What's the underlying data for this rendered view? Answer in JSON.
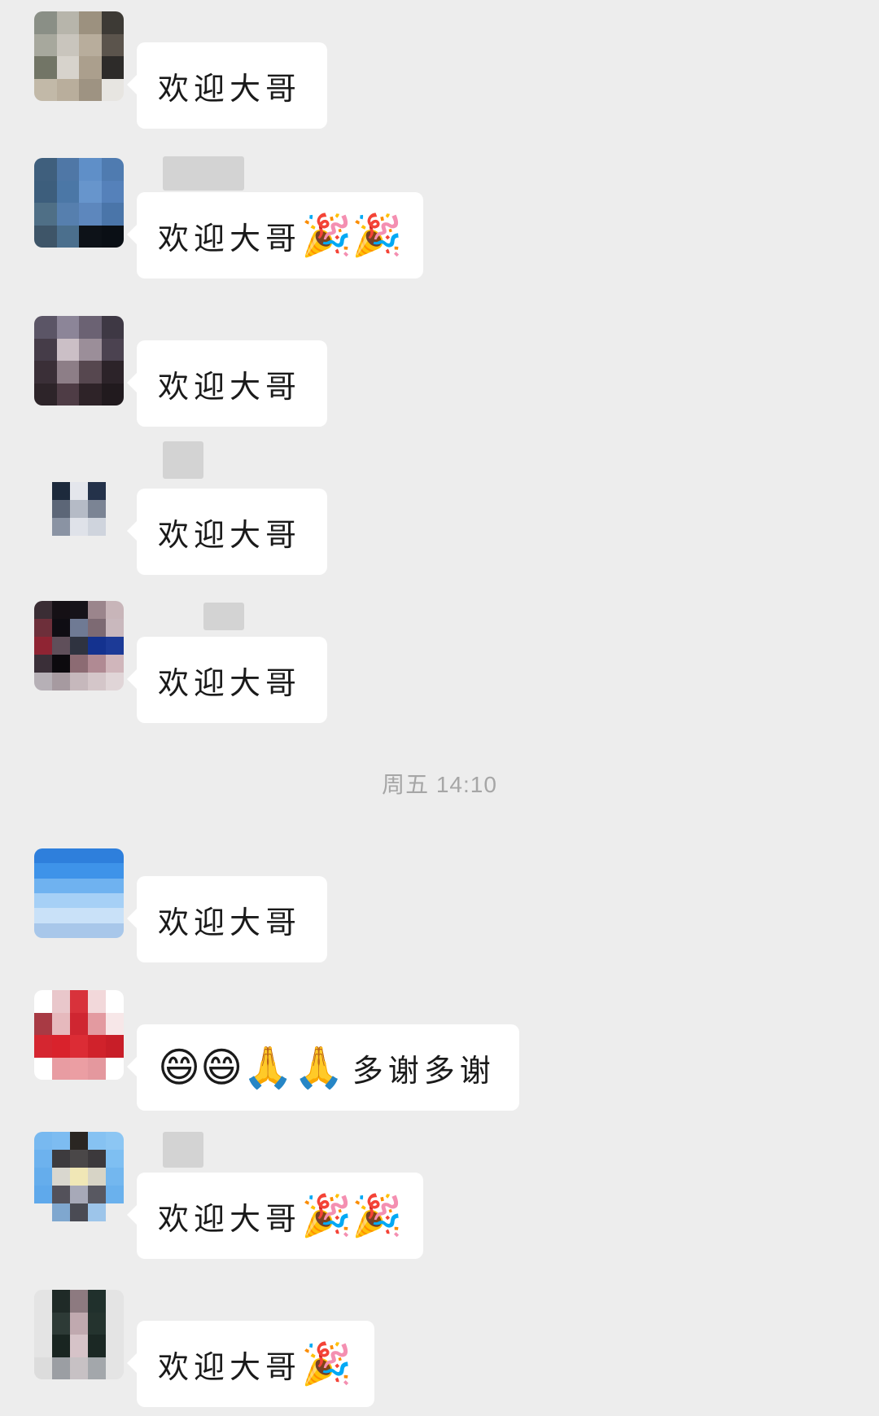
{
  "timestamp": "周五 14:10",
  "messages": [
    {
      "text": "欢迎大哥",
      "emoji": ""
    },
    {
      "text": "欢迎大哥",
      "emoji": "🎉🎉"
    },
    {
      "text": "欢迎大哥",
      "emoji": ""
    },
    {
      "text": "欢迎大哥",
      "emoji": ""
    },
    {
      "text": "欢迎大哥",
      "emoji": ""
    },
    {
      "text": "欢迎大哥",
      "emoji": ""
    },
    {
      "text": "多谢多谢",
      "emoji": "😄😄🙏🙏"
    },
    {
      "text": "欢迎大哥",
      "emoji": "🎉🎉"
    },
    {
      "text": "欢迎大哥",
      "emoji": "🎉"
    }
  ],
  "colors": {
    "background": "#ededed",
    "bubble": "#ffffff",
    "text": "#1a1a1a",
    "timestamp": "#a6a6a6"
  }
}
